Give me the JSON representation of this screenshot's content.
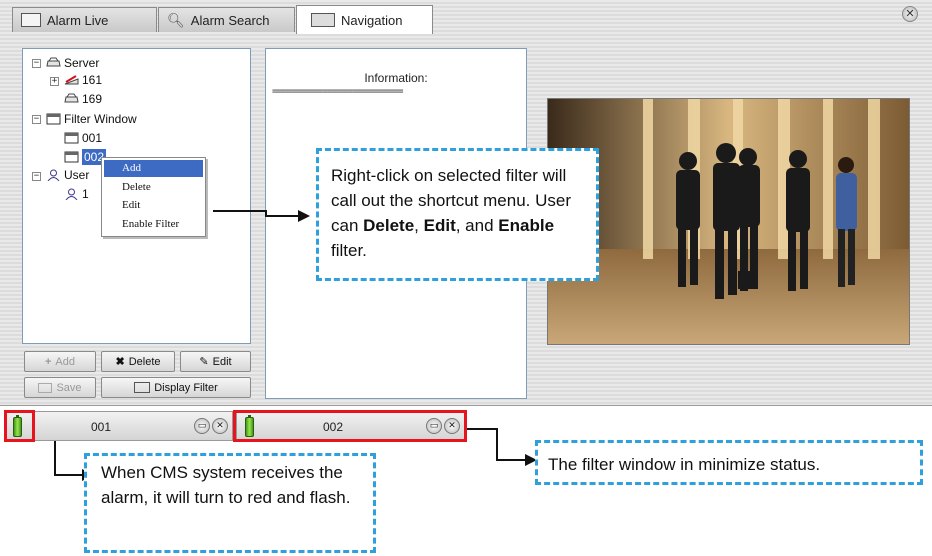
{
  "tabs": [
    {
      "label": "Alarm Live",
      "icon": "alarm-live-icon"
    },
    {
      "label": "Alarm Search",
      "icon": "alarm-search-icon"
    },
    {
      "label": "Navigation",
      "icon": "navigation-icon",
      "active": true
    }
  ],
  "tree": {
    "server": "Server",
    "server_children": [
      "161",
      "169"
    ],
    "filter_window": "Filter Window",
    "filter_children": [
      "001",
      "002"
    ],
    "user": "User",
    "user_children": [
      "1"
    ]
  },
  "context_menu": [
    "Add",
    "Delete",
    "Edit",
    "Enable Filter"
  ],
  "buttons": {
    "add": "Add",
    "delete": "Delete",
    "edit": "Edit",
    "save": "Save",
    "display_filter": "Display Filter"
  },
  "info": {
    "title": "Information:",
    "rule": "=========================="
  },
  "callouts": {
    "context_menu_note_parts": [
      "Right-click on selected filter will call out the shortcut menu. User can ",
      "Delete",
      ", ",
      "Edit",
      ", and ",
      "Enable",
      " filter."
    ],
    "alarm_note": "When CMS system receives the alarm, it will turn to red and flash.",
    "minimize_note": "The filter window in minimize status."
  },
  "minimized_windows": [
    {
      "label": "001"
    },
    {
      "label": "002"
    }
  ],
  "colors": {
    "callout_border": "#2ea1dd",
    "highlight_box": "#e5141d",
    "menu_highlight": "#3d6bc4",
    "status_indicator": "#5cc02a"
  }
}
